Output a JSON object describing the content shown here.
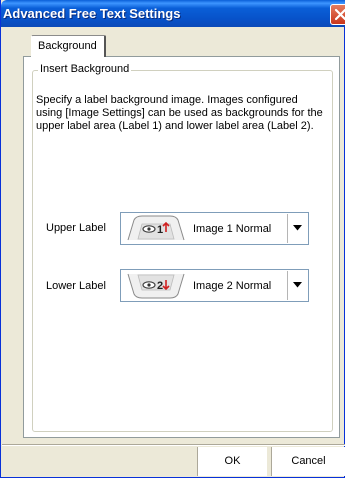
{
  "window": {
    "title": "Advanced Free Text Settings"
  },
  "icons": {
    "close": "close-icon",
    "dropdown": "chevron-down-icon",
    "label_image": "eye-icon"
  },
  "colors": {
    "titlebar": "#0a5fd8",
    "accent_red": "#d02020"
  },
  "tabs": [
    {
      "label": "Background",
      "selected": true
    }
  ],
  "group": {
    "title": "Insert Background",
    "description": "Specify a label background image. Images configured using [Image Settings] can be used as backgrounds for the upper label area (Label 1) and lower label area (Label 2)."
  },
  "upper": {
    "label": "Upper Label",
    "image_number": "1",
    "value": "Image 1 Normal"
  },
  "lower": {
    "label": "Lower Label",
    "image_number": "2",
    "value": "Image 2 Normal"
  },
  "buttons": {
    "ok": "OK",
    "cancel": "Cancel"
  }
}
